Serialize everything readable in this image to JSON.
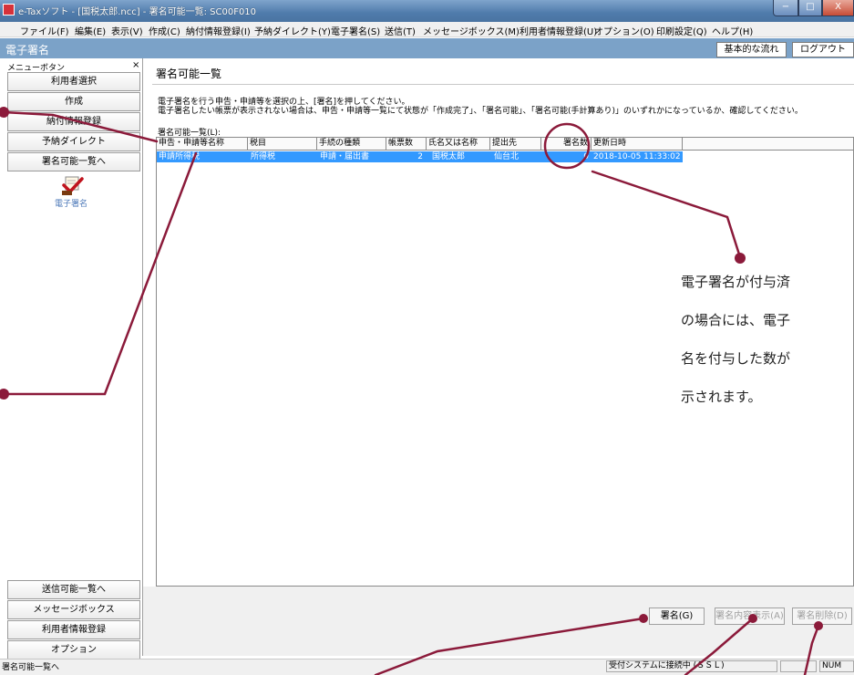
{
  "window": {
    "title": "e-Taxソフト - [国税太郎.ncc] - 署名可能一覧: SC00F010",
    "min_glyph": "−",
    "max_glyph": "□",
    "close_glyph": "X"
  },
  "menu": [
    "ファイル(F)",
    "編集(E)",
    "表示(V)",
    "作成(C)",
    "納付情報登録(I)",
    "予納ダイレクト(Y)",
    "電子署名(S)",
    "送信(T)",
    "メッセージボックス(M)",
    "利用者情報登録(U)",
    "オプション(O)",
    "印刷設定(Q)",
    "ヘルプ(H)"
  ],
  "header": {
    "title": "電子署名",
    "flow_button": "基本的な流れ",
    "logout_button": "ログアウト"
  },
  "sidebar": {
    "caption": "メニューボタン",
    "close_glyph": "×",
    "top_buttons": [
      "利用者選択",
      "作成",
      "納付情報登録",
      "予納ダイレクト",
      "署名可能一覧へ"
    ],
    "icon_label": "電子署名",
    "bottom_buttons": [
      "送信可能一覧へ",
      "メッセージボックス",
      "利用者情報登録",
      "オプション"
    ]
  },
  "main": {
    "title": "署名可能一覧",
    "instruction_1": "電子署名を行う申告・申請等を選択の上、[署名]を押してください。",
    "instruction_2": "電子署名したい帳票が表示されない場合は、申告・申請等一覧にて状態が「作成完了」、「署名可能」、「署名可能(手計算あり)」のいずれかになっているか、確認してください。",
    "list_caption": "署名可能一覧(L):",
    "columns": [
      "申告・申請等名称",
      "税目",
      "手続の種類",
      "帳票数",
      "氏名又は名称",
      "提出先",
      "署名数",
      "更新日時"
    ],
    "rows": [
      [
        "申請所得税",
        "所得税",
        "申請・届出書",
        "2",
        "国税太郎",
        "仙台北",
        "0",
        "2018-10-05 11:33:02"
      ]
    ]
  },
  "buttons": {
    "sign": "署名(G)",
    "view": "署名内容表示(A)",
    "delete": "署名削除(D)"
  },
  "status": {
    "left": "署名可能一覧へ",
    "connection": "受付システムに接続中 (ＳＳＬ)",
    "num": "NUM"
  },
  "callout": {
    "lines": [
      "電子署名が付与済",
      "の場合には、電子",
      "名を付与した数が",
      "示されます。"
    ]
  },
  "colors": {
    "header_band": "#7ba2c8",
    "selection": "#3399ff",
    "annotation": "#8b1a3a"
  }
}
